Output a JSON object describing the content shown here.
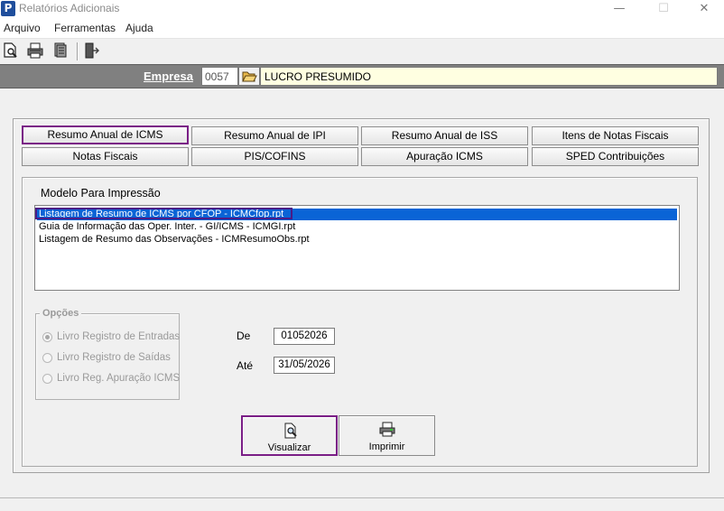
{
  "window": {
    "title": "Relatórios Adicionais",
    "app_icon_letter": "P",
    "minimize_glyph": "—",
    "maximize_glyph": "☐",
    "close_glyph": "✕"
  },
  "menu": [
    "Arquivo",
    "Ferramentas",
    "Ajuda"
  ],
  "toolbar": [
    "preview-icon",
    "print-icon",
    "print-setup-icon",
    "exit-door-icon"
  ],
  "empresa": {
    "label": "Empresa",
    "code": "0057",
    "name": "LUCRO PRESUMIDO"
  },
  "tabs": [
    {
      "label": "Resumo Anual de ICMS",
      "selected": true
    },
    {
      "label": "Resumo Anual de IPI",
      "selected": false
    },
    {
      "label": "Resumo Anual de ISS",
      "selected": false
    },
    {
      "label": "Itens de Notas Fiscais",
      "selected": false
    },
    {
      "label": "Notas Fiscais",
      "selected": false
    },
    {
      "label": "PIS/COFINS",
      "selected": false
    },
    {
      "label": "Apuração ICMS",
      "selected": false
    },
    {
      "label": "SPED Contribuições",
      "selected": false
    }
  ],
  "modelo": {
    "title": "Modelo Para Impressão",
    "items": [
      "Listagem de Resumo de ICMS por CFOP - ICMCfop.rpt",
      "Guia de Informação das Oper. Inter. - GI/ICMS - ICMGI.rpt",
      "Listagem de Resumo das Observações - ICMResumoObs.rpt"
    ],
    "selected_index": 0
  },
  "opcoes": {
    "title": "Opções",
    "items": [
      {
        "label": "Livro Registro de Entradas",
        "checked": true
      },
      {
        "label": "Livro Registro de Saídas",
        "checked": false
      },
      {
        "label": "Livro Reg. Apuração ICMS",
        "checked": false
      }
    ]
  },
  "periodo": {
    "de_label": "De",
    "de_value": "01052026",
    "ate_label": "Até",
    "ate_value": "31/05/2026"
  },
  "actions": {
    "visualizar": "Visualizar",
    "imprimir": "Imprimir"
  },
  "colors": {
    "highlight_border": "#7a1e86",
    "selection_blue": "#0a64d6",
    "empresa_bar": "#808080",
    "name_field_bg": "#ffffe1"
  }
}
